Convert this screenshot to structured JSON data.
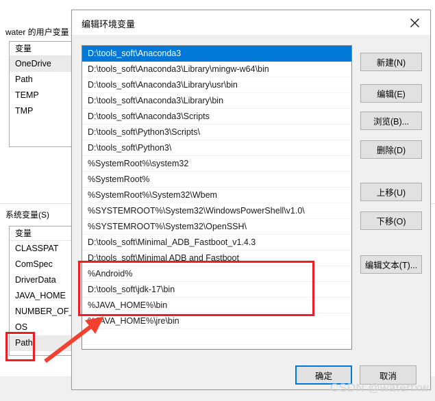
{
  "background_window": {
    "user_vars_label": "water 的用户变量",
    "system_vars_label": "系统变量(S)",
    "column_header": "变量",
    "user_vars": [
      {
        "name": "OneDrive",
        "highlighted": true
      },
      {
        "name": "Path",
        "highlighted": false
      },
      {
        "name": "TEMP",
        "highlighted": false
      },
      {
        "name": "TMP",
        "highlighted": false
      }
    ],
    "system_vars": [
      {
        "name": "CLASSPAT",
        "highlighted": false
      },
      {
        "name": "ComSpec",
        "highlighted": false
      },
      {
        "name": "DriverData",
        "highlighted": false
      },
      {
        "name": "JAVA_HOME",
        "highlighted": false
      },
      {
        "name": "NUMBER_OF_F",
        "highlighted": false
      },
      {
        "name": "OS",
        "highlighted": false
      },
      {
        "name": "Path",
        "highlighted": true
      }
    ]
  },
  "dialog": {
    "title": "编辑环境变量",
    "close_icon": "close-icon",
    "paths": [
      {
        "value": "D:\\tools_soft\\Anaconda3",
        "selected": true
      },
      {
        "value": "D:\\tools_soft\\Anaconda3\\Library\\mingw-w64\\bin",
        "selected": false
      },
      {
        "value": "D:\\tools_soft\\Anaconda3\\Library\\usr\\bin",
        "selected": false
      },
      {
        "value": "D:\\tools_soft\\Anaconda3\\Library\\bin",
        "selected": false
      },
      {
        "value": "D:\\tools_soft\\Anaconda3\\Scripts",
        "selected": false
      },
      {
        "value": "D:\\tools_soft\\Python3\\Scripts\\",
        "selected": false
      },
      {
        "value": "D:\\tools_soft\\Python3\\",
        "selected": false
      },
      {
        "value": "%SystemRoot%\\system32",
        "selected": false
      },
      {
        "value": "%SystemRoot%",
        "selected": false
      },
      {
        "value": "%SystemRoot%\\System32\\Wbem",
        "selected": false
      },
      {
        "value": "%SYSTEMROOT%\\System32\\WindowsPowerShell\\v1.0\\",
        "selected": false
      },
      {
        "value": "%SYSTEMROOT%\\System32\\OpenSSH\\",
        "selected": false
      },
      {
        "value": "D:\\tools_soft\\Minimal_ADB_Fastboot_v1.4.3",
        "selected": false
      },
      {
        "value": "D:\\tools_soft\\Minimal ADB and Fastboot",
        "selected": false
      },
      {
        "value": "%Android%",
        "selected": false
      },
      {
        "value": "D:\\tools_soft\\jdk-17\\bin",
        "selected": false
      },
      {
        "value": "%JAVA_HOME%\\bin",
        "selected": false
      },
      {
        "value": "%JAVA_HOME%\\jre\\bin",
        "selected": false
      },
      {
        "value": "",
        "selected": false
      },
      {
        "value": "",
        "selected": false
      }
    ],
    "side_buttons": {
      "new": "新建(N)",
      "edit": "编辑(E)",
      "browse": "浏览(B)...",
      "delete": "删除(D)",
      "move_up": "上移(U)",
      "move_down": "下移(O)",
      "edit_text": "编辑文本(T)..."
    },
    "footer_buttons": {
      "ok": "确定",
      "cancel": "取消"
    }
  },
  "annotations": {
    "accent_color": "#ee1c25",
    "highlight_box_paths": "red-box-java-paths",
    "highlight_box_path_variable": "red-box-path-variable",
    "arrow": "red-arrow"
  },
  "watermark": {
    "text": "CSDN @waterfxw"
  }
}
